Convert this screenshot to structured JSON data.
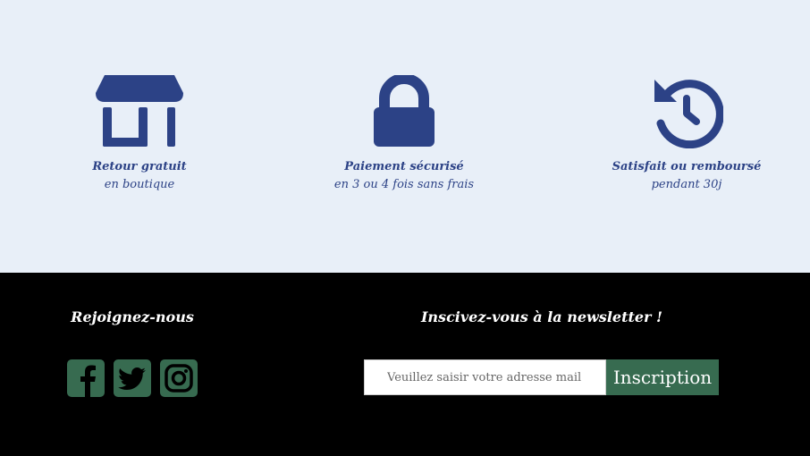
{
  "features": [
    {
      "icon": "store-icon",
      "title": "Retour gratuit",
      "subtitle": "en boutique"
    },
    {
      "icon": "lock-icon",
      "title": "Paiement sécurisé",
      "subtitle": "en 3 ou 4 fois sans frais"
    },
    {
      "icon": "history-icon",
      "title": "Satisfait ou remboursé",
      "subtitle": "pendant 30j"
    }
  ],
  "footer": {
    "join_title": "Rejoignez-nous",
    "social": [
      {
        "icon": "facebook-icon"
      },
      {
        "icon": "twitter-icon"
      },
      {
        "icon": "instagram-icon"
      }
    ],
    "newsletter_title": "Inscivez-vous à la newsletter !",
    "newsletter_placeholder": "Veuillez saisir votre adresse mail",
    "newsletter_button": "Inscription"
  },
  "colors": {
    "feature_bg": "#e8eff8",
    "feature_text": "#2c4286",
    "footer_bg": "#000000",
    "accent_green": "#376b50"
  }
}
